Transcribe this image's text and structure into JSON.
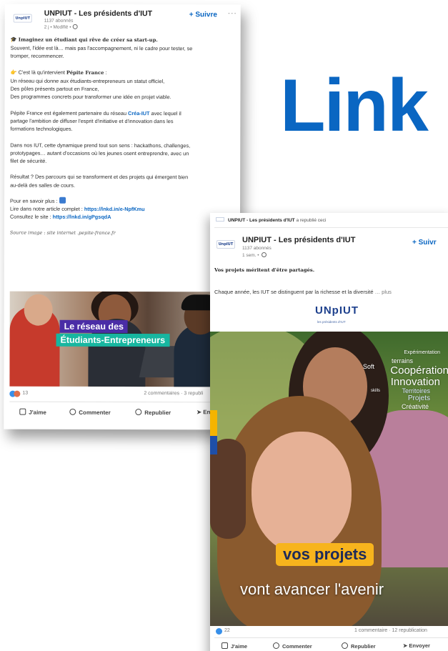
{
  "brand": {
    "text": "Link"
  },
  "post1": {
    "logo_text": "UnpIUT",
    "org_name": "UNPIUT - Les présidents d'IUT",
    "followers": "1137 abonnés",
    "meta": "2 j • Modifié •",
    "follow_label": "+ Suivre",
    "more_label": "···",
    "line_title": "Imaginez un étudiant qui rêve de créer sa start-up.",
    "line_1": "Souvent, l'idée est là… mais pas l'accompagnement, ni le cadre pour tester, se",
    "line_2": "tromper, recommencer.",
    "intro_prefix": "C'est là qu'intervient ",
    "intro_brand": "Pépite France",
    "intro_suffix": " :",
    "line_3": "Un réseau qui donne aux étudiants-entrepreneurs un statut officiel,",
    "line_4": "Des pôles présents partout en France,",
    "line_5": "Des programmes concrets pour transformer une idée en projet viable.",
    "partner_prefix": "Pépite France est également partenaire du réseau ",
    "partner_link": "Créa-IUT",
    "partner_suffix": " avec lequel il",
    "line_6": "partage l'ambition de diffuser l'esprit d'initiative et d'innovation dans les",
    "line_7": "formations technologiques.",
    "line_8": "Dans nos IUT, cette dynamique prend tout son sens : hackathons, challenges,",
    "line_9": "prototypages… autant d'occasions où les jeunes osent entreprendre, avec un",
    "line_10": "filet de sécurité.",
    "line_11": "Résultat ? Des parcours qui se transforment et des projets qui émergent bien",
    "line_12": "au-delà des salles de cours.",
    "learn_more": "Pour en savoir plus :",
    "article_prefix": "Lire dans notre article complet : ",
    "article_link": "https://lnkd.in/e-NpfKmu",
    "site_prefix": "Consultez le site : ",
    "site_link": "https://lnkd.in/gPgsqdA",
    "source": "Source image : site internet .pepite-france.fr",
    "image_line1": "Le réseau des",
    "image_line2": "Étudiants-Entrepreneurs",
    "reactions": "13",
    "comments": "2 commentaires · 3 republi",
    "actions": {
      "like": "J'aime",
      "comment": "Commenter",
      "repost": "Republier",
      "send": "Env"
    }
  },
  "post2": {
    "reposted_by": "UNPIUT - Les présidents d'IUT",
    "reposted_suffix": " a republié ceci",
    "logo_text": "UnpIUT",
    "org_name": "UNPIUT - Les présidents d'IUT",
    "followers": "1137 abonnés",
    "meta": "1 sem. •",
    "follow_label": "+ Suivr",
    "headline": "Vos projets méritent d'être partagés.",
    "text": "Chaque année, les IUT se distinguent par la richesse et la diversité",
    "more": "… plus",
    "brand_logo": "UNpIUT",
    "brand_tag": "les présidents d'IUT",
    "words": {
      "w1": "Expérimentation",
      "w2": "terrains",
      "w3": "Soft",
      "w4": "Coopération",
      "w5": "Innovation",
      "w6": "skills",
      "w7": "Territoires",
      "w8": "Projets",
      "w9": "Créativité"
    },
    "badge": "vos projets",
    "tagline": "vont avancer l'avenir",
    "reactions": "22",
    "comments": "1 commentaire · 12 republication",
    "actions": {
      "like": "J'aime",
      "comment": "Commenter",
      "repost": "Republier",
      "send": "Envoyer"
    }
  },
  "colors": {
    "linkedin_blue": "#0a66c2",
    "unpiut_navy": "#1c3f8c"
  }
}
